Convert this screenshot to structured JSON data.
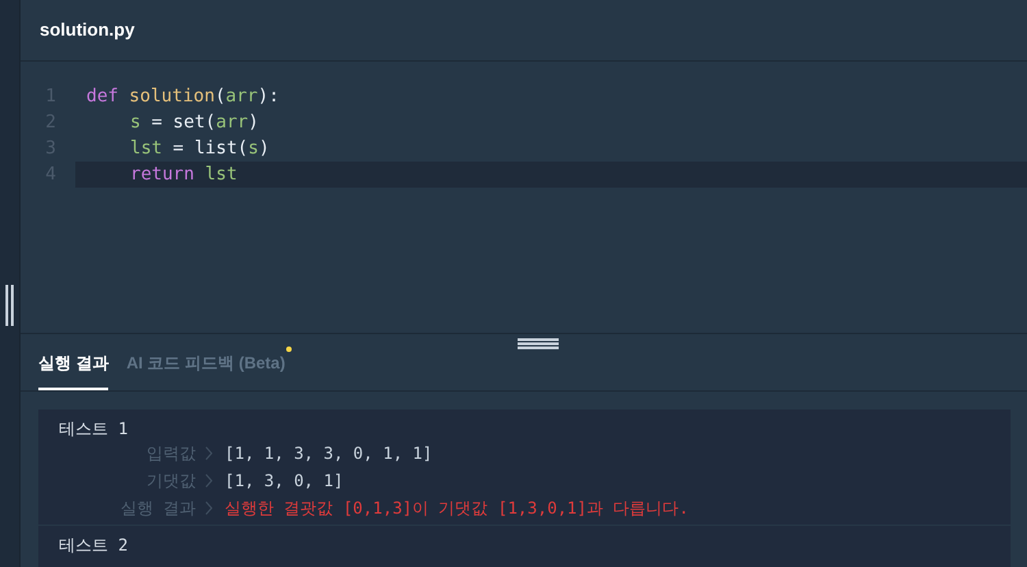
{
  "editor": {
    "filename": "solution.py",
    "lines": [
      {
        "number": "1",
        "indented": false,
        "tokens": [
          {
            "kind": "keyword",
            "text": "def"
          },
          {
            "kind": "function",
            "text": " solution"
          },
          {
            "kind": "plain",
            "text": "("
          },
          {
            "kind": "name",
            "text": "arr"
          },
          {
            "kind": "plain",
            "text": "):"
          }
        ],
        "active": false
      },
      {
        "number": "2",
        "indented": true,
        "tokens": [
          {
            "kind": "name",
            "text": "s"
          },
          {
            "kind": "plain",
            "text": " = set("
          },
          {
            "kind": "name",
            "text": "arr"
          },
          {
            "kind": "plain",
            "text": ")"
          }
        ],
        "active": false
      },
      {
        "number": "3",
        "indented": true,
        "tokens": [
          {
            "kind": "name",
            "text": "lst"
          },
          {
            "kind": "plain",
            "text": " = list("
          },
          {
            "kind": "name",
            "text": "s"
          },
          {
            "kind": "plain",
            "text": ")"
          }
        ],
        "active": false
      },
      {
        "number": "4",
        "indented": true,
        "tokens": [
          {
            "kind": "keyword",
            "text": "return"
          },
          {
            "kind": "name",
            "text": " lst"
          }
        ],
        "active": true
      }
    ]
  },
  "tabs": [
    {
      "label": "실행 결과",
      "selected": true,
      "new": false
    },
    {
      "label": "AI 코드 피드백 (Beta)",
      "selected": false,
      "new": true
    }
  ],
  "tests": [
    {
      "title": "테스트 1",
      "rows": [
        {
          "label": "입력값",
          "value": "[1, 1, 3, 3, 0, 1, 1]",
          "error": false
        },
        {
          "label": "기댓값",
          "value": "[1, 3, 0, 1]",
          "error": false
        },
        {
          "label": "실행 결과",
          "value": "실행한 결괏값 [0,1,3]이 기댓값 [1,3,0,1]과 다릅니다.",
          "error": true
        }
      ]
    },
    {
      "title": "테스트 2"
    }
  ]
}
